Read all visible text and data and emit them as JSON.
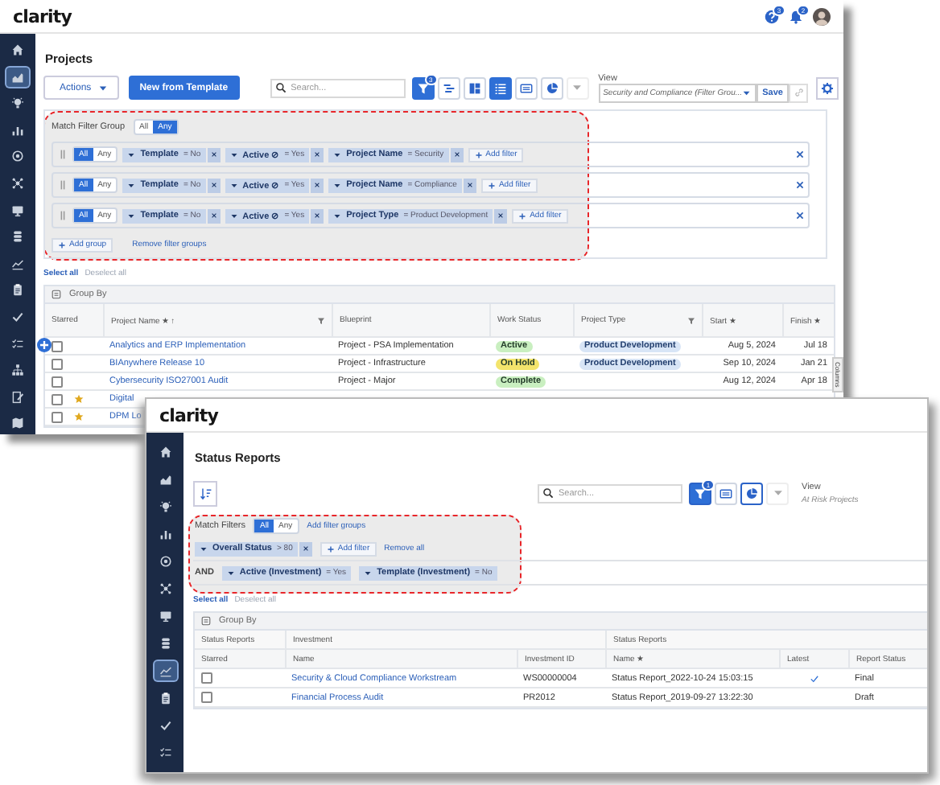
{
  "projects_window": {
    "logo": "clarity",
    "help_badge": "3",
    "notification_badge": "2",
    "sidebar": [
      {
        "selected": false
      },
      {
        "selected": true
      },
      {
        "selected": false
      },
      {
        "selected": false
      },
      {
        "selected": false
      },
      {
        "selected": false
      },
      {
        "selected": false
      },
      {
        "selected": false
      },
      {
        "selected": false
      },
      {
        "selected": false
      },
      {
        "selected": false
      },
      {
        "selected": false
      },
      {
        "selected": false
      },
      {
        "selected": false
      },
      {
        "selected": false
      }
    ],
    "title": "Projects",
    "toolbar": {
      "actions": "Actions",
      "new_button": "New from Template",
      "search_placeholder": "Search...",
      "filter": {
        "selected": true,
        "badge": "3"
      },
      "view_modes": [
        {
          "selected": false
        },
        {
          "selected": false
        },
        {
          "selected": true
        },
        {
          "selected": false
        },
        {
          "selected": false
        }
      ],
      "view": {
        "label": "View",
        "value": "Security and Compliance (Filter Grou..."
      },
      "save": "Save"
    },
    "filter_panel": {
      "label": "Match Filter Group",
      "modes": [
        {
          "label": "All",
          "selected": false
        },
        {
          "label": "Any",
          "selected": true
        }
      ],
      "groups": [
        {
          "modes": [
            {
              "label": "All",
              "selected": true
            },
            {
              "label": "Any",
              "selected": false
            }
          ],
          "filters": [
            {
              "field": "Template",
              "value": "= No",
              "removable": true
            },
            {
              "field": "Active ⊘",
              "value": "= Yes",
              "removable": true
            },
            {
              "field": "Project Name",
              "value": "= Security",
              "removable": true
            }
          ],
          "add_filter": "Add filter"
        },
        {
          "modes": [
            {
              "label": "All",
              "selected": true
            },
            {
              "label": "Any",
              "selected": false
            }
          ],
          "filters": [
            {
              "field": "Template",
              "value": "= No",
              "removable": true
            },
            {
              "field": "Active ⊘",
              "value": "= Yes",
              "removable": true
            },
            {
              "field": "Project Name",
              "value": "= Compliance",
              "removable": true
            }
          ],
          "add_filter": "Add filter"
        },
        {
          "modes": [
            {
              "label": "All",
              "selected": true
            },
            {
              "label": "Any",
              "selected": false
            }
          ],
          "filters": [
            {
              "field": "Template",
              "value": "= No",
              "removable": true
            },
            {
              "field": "Active ⊘",
              "value": "= Yes",
              "removable": true
            },
            {
              "field": "Project Type",
              "value": "= Product Development",
              "removable": true
            }
          ],
          "add_filter": "Add filter"
        }
      ],
      "add_group": "Add group",
      "remove_groups": "Remove filter groups"
    },
    "selection": {
      "select_all": "Select all",
      "deselect_all": "Deselect all",
      "deselect_disabled": true
    },
    "table": {
      "group_by": "Group By",
      "columns_tab": "Columns",
      "columns": [
        {
          "label": "Starred",
          "filter": false
        },
        {
          "label": "Project Name ★ ↑",
          "filter": true
        },
        {
          "label": "Blueprint",
          "filter": false
        },
        {
          "label": "Work Status",
          "filter": false
        },
        {
          "label": "Project Type",
          "filter": true
        },
        {
          "label": "Start ★",
          "filter": false
        },
        {
          "label": "Finish ★",
          "filter": false
        }
      ],
      "rows": [
        {
          "checked": false,
          "starred": false,
          "name": "Analytics and ERP Implementation",
          "blueprint": "Project - PSA Implementation",
          "status": {
            "label": "Active",
            "color": "#c9efc0"
          },
          "type": "Product Development",
          "start": "Aug 5, 2024",
          "finish": "Jul 18"
        },
        {
          "checked": false,
          "starred": false,
          "name": "BIAnywhere Release 10",
          "blueprint": "Project - Infrastructure",
          "status": {
            "label": "On Hold",
            "color": "#f3e46c"
          },
          "type": "Product Development",
          "start": "Sep 10, 2024",
          "finish": "Jan 21"
        },
        {
          "checked": false,
          "starred": false,
          "name": "Cybersecurity ISO27001 Audit",
          "blueprint": "Project - Major",
          "status": {
            "label": "Complete",
            "color": "#c9efc0"
          },
          "start": "Aug 12, 2024",
          "finish": "Apr 18"
        },
        {
          "checked": false,
          "starred": true,
          "name": "Digital"
        },
        {
          "checked": false,
          "starred": true,
          "name": "DPM Lo"
        }
      ]
    }
  },
  "status_reports_window": {
    "logo": "clarity",
    "sidebar": [
      {
        "selected": false
      },
      {
        "selected": false
      },
      {
        "selected": false
      },
      {
        "selected": false
      },
      {
        "selected": false
      },
      {
        "selected": false
      },
      {
        "selected": false
      },
      {
        "selected": false
      },
      {
        "selected": true
      },
      {
        "selected": false
      },
      {
        "selected": false
      },
      {
        "selected": false
      }
    ],
    "title": "Status Reports",
    "toolbar": {
      "search_placeholder": "Search...",
      "filter": {
        "selected": true,
        "badge": "1"
      },
      "view_modes": [
        {
          "selected": false
        },
        {
          "selected": true
        }
      ],
      "view": {
        "label": "View",
        "value": "At Risk Projects"
      }
    },
    "filter_panel": {
      "label": "Match Filters",
      "modes": [
        {
          "label": "All",
          "selected": true
        },
        {
          "label": "Any",
          "selected": false
        }
      ],
      "add_groups": "Add filter groups",
      "filters": [
        {
          "field": "Overall Status",
          "value": "> 80",
          "removable": true
        }
      ],
      "add_filter": "Add filter",
      "remove_all": "Remove all",
      "joined": {
        "operator": "AND",
        "filters": [
          {
            "field": "Active (Investment)",
            "value": "= Yes",
            "removable": false
          },
          {
            "field": "Template (Investment)",
            "value": "= No",
            "removable": false
          }
        ]
      }
    },
    "selection": {
      "select_all": "Select all",
      "deselect_all": "Deselect all",
      "deselect_disabled": true
    },
    "table": {
      "group_by": "Group By",
      "column_groups": [
        "Status Reports",
        "Investment",
        "Status Reports"
      ],
      "columns": [
        "Starred",
        "Name",
        "Investment ID",
        "Name ★",
        "Latest",
        "Report Status"
      ],
      "rows": [
        {
          "checked": false,
          "name": "Security & Cloud Compliance Workstream",
          "investment_id": "WS00000004",
          "report": "Status Report_2022-10-24 15:03:15",
          "latest": true,
          "report_status": "Final"
        },
        {
          "checked": false,
          "name": "Financial Process Audit",
          "investment_id": "PR2012",
          "report": "Status Report_2019-09-27 13:22:30",
          "latest": false,
          "report_status": "Draft"
        }
      ]
    }
  }
}
